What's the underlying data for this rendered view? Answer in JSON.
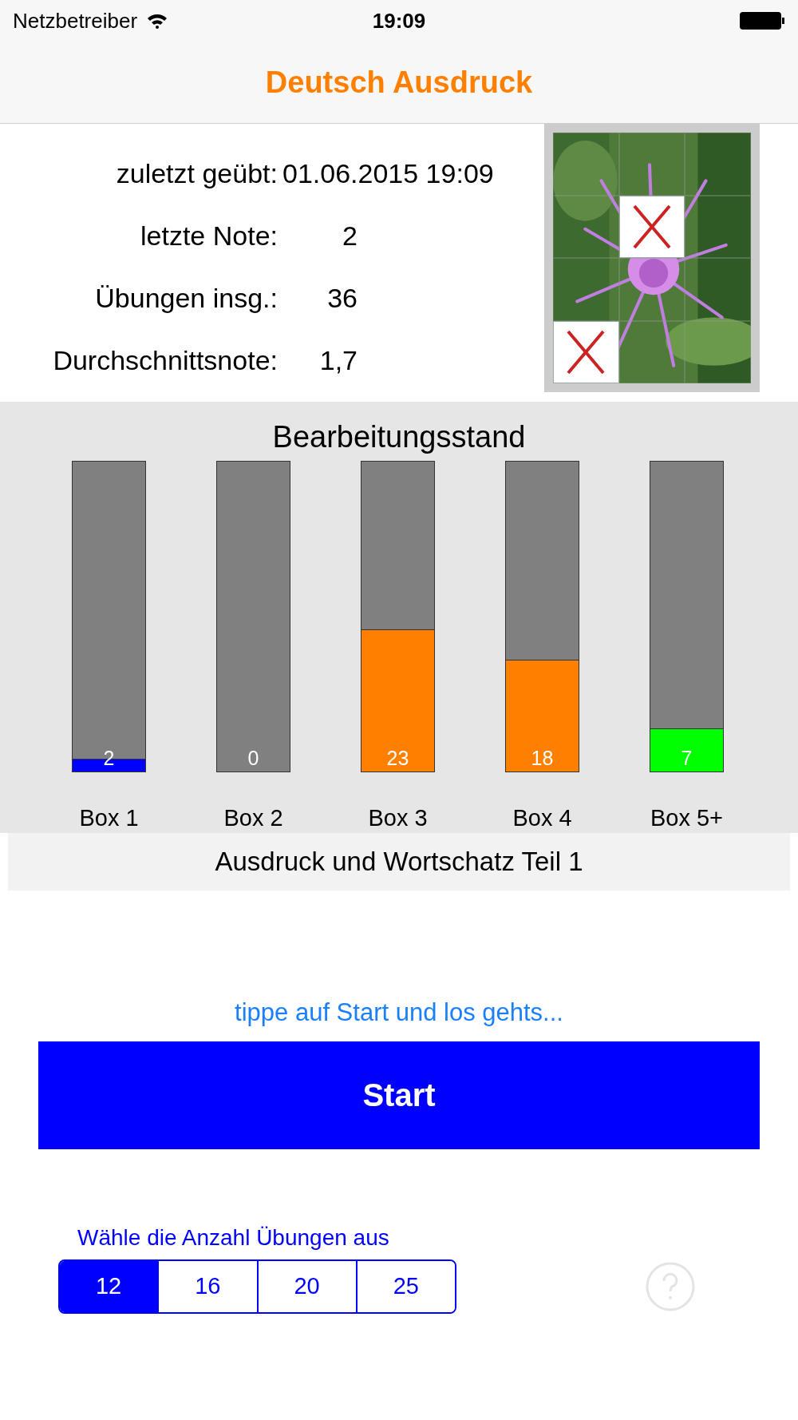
{
  "status_bar": {
    "carrier": "Netzbetreiber",
    "time": "19:09"
  },
  "nav": {
    "title": "Deutsch Ausdruck"
  },
  "stats": [
    {
      "label": "zuletzt geübt:",
      "value": "01.06.2015 19:09"
    },
    {
      "label": "letzte Note:",
      "value": "2"
    },
    {
      "label": "Übungen insg.:",
      "value": "36"
    },
    {
      "label": "Durchschnittsnote:",
      "value": "1,7"
    }
  ],
  "puzzle": {
    "tiles": [
      {
        "covered": false
      },
      {
        "covered": false
      },
      {
        "covered": false
      },
      {
        "covered": false
      },
      {
        "covered": true
      },
      {
        "covered": false
      },
      {
        "covered": false
      },
      {
        "covered": false
      },
      {
        "covered": false
      },
      {
        "covered": true
      },
      {
        "covered": false
      },
      {
        "covered": false
      }
    ]
  },
  "progress": {
    "title": "Bearbeitungsstand",
    "boxes": [
      {
        "label": "Box 1",
        "count": "2",
        "level": 0.04,
        "color": "#0000ff"
      },
      {
        "label": "Box 2",
        "count": "0"
      },
      {
        "label": "Box 3",
        "count": "23",
        "level": 0.46,
        "color": "#ff8000"
      },
      {
        "label": "Box 4",
        "count": "18",
        "level": 0.36,
        "color": "#ff8000"
      },
      {
        "label": "Box 5+",
        "count": "7",
        "level": 0.14,
        "color": "#00ff00"
      }
    ]
  },
  "unit": {
    "title": "Ausdruck und Wortschatz Teil 1"
  },
  "hint": "tippe auf Start und los gehts...",
  "start_button": "Start",
  "count_picker": {
    "label": "Wähle die Anzahl Übungen aus",
    "options": [
      {
        "label": "12",
        "selected": true
      },
      {
        "label": "16",
        "selected": false
      },
      {
        "label": "20",
        "selected": false
      },
      {
        "label": "25",
        "selected": false
      }
    ]
  }
}
